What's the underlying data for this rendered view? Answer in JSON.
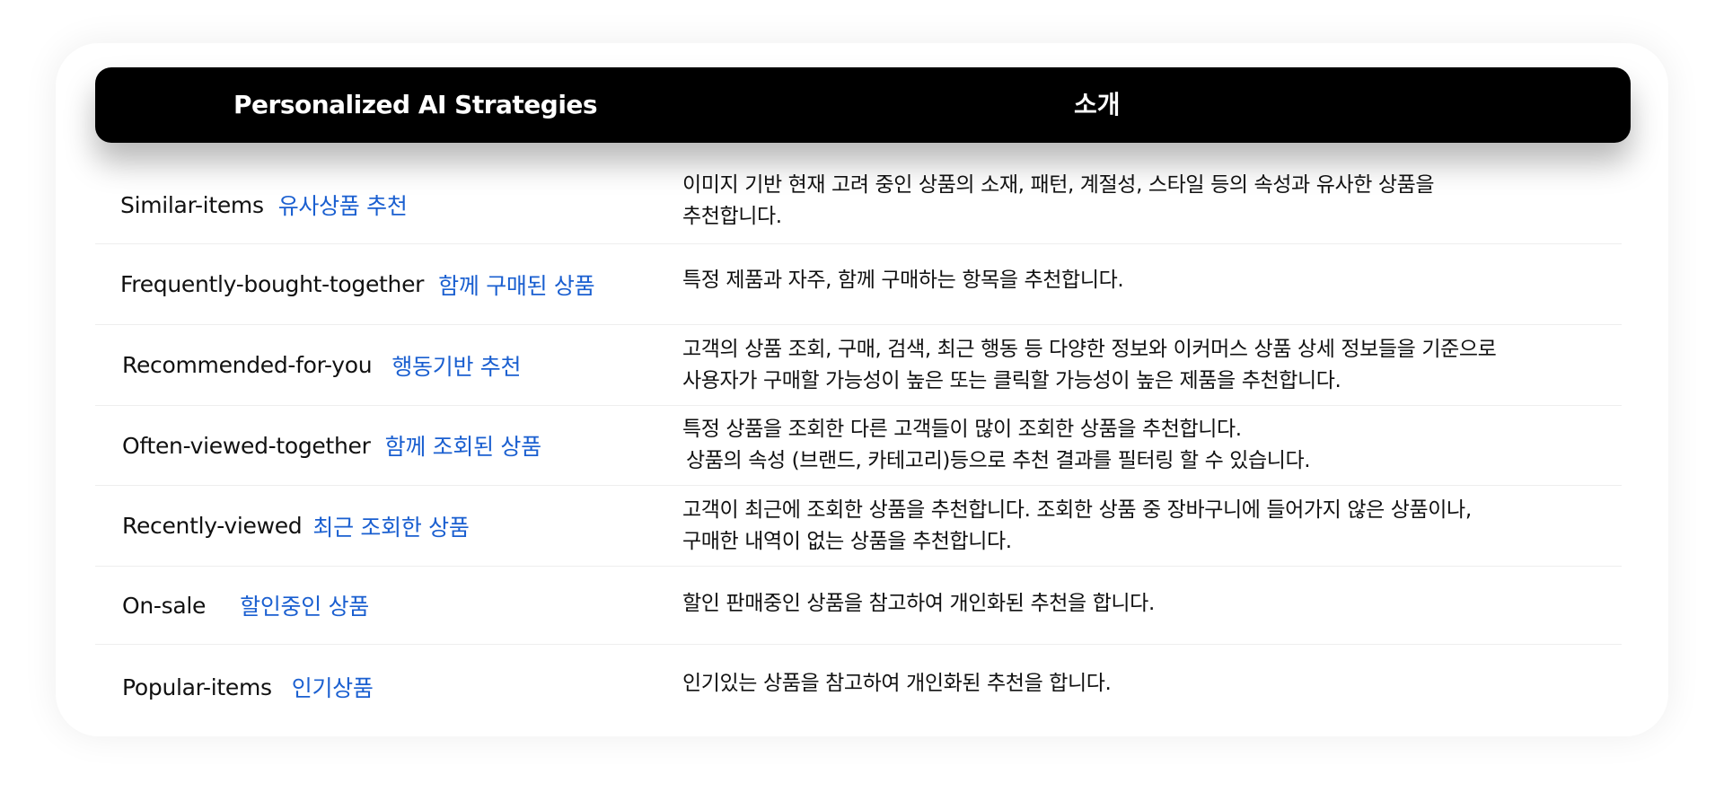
{
  "header": {
    "col1": "Personalized AI Strategies",
    "col2": "소개"
  },
  "rows": [
    {
      "en": "Similar-items",
      "ko": "유사상품 추천",
      "desc": [
        "이미지 기반 현재 고려 중인 상품의 소재, 패턴, 계절성, 스타일 등의 속성과 유사한 상품을",
        "추천합니다."
      ]
    },
    {
      "en": "Frequently-bought-together",
      "ko": "함께 구매된 상품",
      "desc": [
        "특정 제품과 자주, 함께 구매하는 항목을 추천합니다."
      ]
    },
    {
      "en": "Recommended-for-you",
      "ko": "행동기반 추천",
      "desc": [
        "고객의 상품 조회, 구매, 검색, 최근 행동 등 다양한 정보와 이커머스 상품 상세 정보들을 기준으로",
        "사용자가 구매할 가능성이 높은 또는 클릭할 가능성이 높은 제품을 추천합니다."
      ]
    },
    {
      "en": "Often-viewed-together",
      "ko": "함께 조회된 상품",
      "desc": [
        "특정 상품을 조회한 다른 고객들이 많이 조회한 상품을 추천합니다.",
        "상품의 속성 (브랜드, 카테고리)등으로 추천 결과를 필터링 할 수 있습니다."
      ]
    },
    {
      "en": "Recently-viewed",
      "ko": "최근 조회한 상품",
      "desc": [
        "고객이 최근에 조회한 상품을 추천합니다. 조회한 상품 중 장바구니에 들어가지 않은 상품이나,",
        "구매한 내역이 없는 상품을 추천합니다."
      ]
    },
    {
      "en": "On-sale",
      "ko": "할인중인 상품",
      "desc": [
        "할인 판매중인 상품을 참고하여 개인화된 추천을 합니다."
      ]
    },
    {
      "en": "Popular-items",
      "ko": "인기상품",
      "desc": [
        "인기있는 상품을 참고하여 개인화된 추천을 합니다."
      ]
    }
  ],
  "colors": {
    "header_bg": "#000000",
    "korean_label": "#1a5fd0"
  }
}
